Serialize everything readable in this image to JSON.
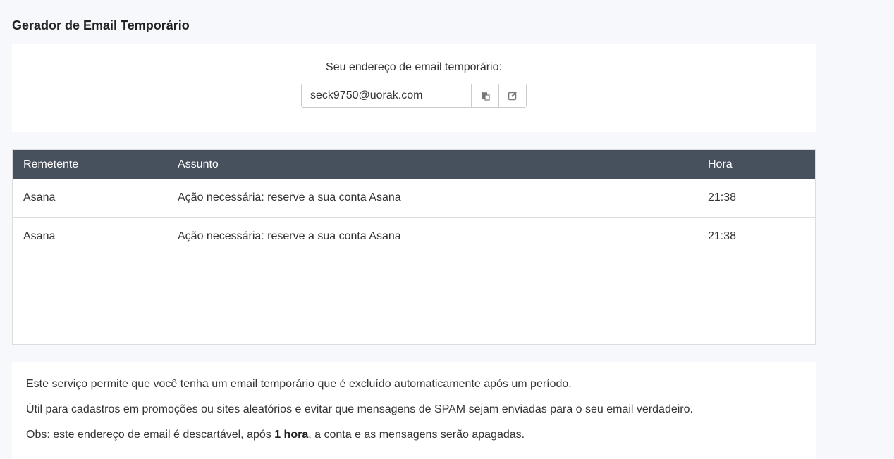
{
  "page": {
    "title": "Gerador de Email Temporário"
  },
  "email": {
    "label": "Seu endereço de email temporário:",
    "address": "seck9750@uorak.com"
  },
  "inbox": {
    "headers": {
      "sender": "Remetente",
      "subject": "Assunto",
      "time": "Hora"
    },
    "rows": [
      {
        "sender": "Asana",
        "subject": "Ação necessária: reserve a sua conta Asana",
        "time": "21:38"
      },
      {
        "sender": "Asana",
        "subject": "Ação necessária: reserve a sua conta Asana",
        "time": "21:38"
      }
    ]
  },
  "info": {
    "line1": "Este serviço permite que você tenha um email temporário que é excluído automaticamente após um período.",
    "line2": "Útil para cadastros em promoções ou sites aleatórios e evitar que mensagens de SPAM sejam enviadas para o seu email verdadeiro.",
    "line3_prefix": "Obs: este endereço de email é descartável, após ",
    "line3_bold": "1 hora",
    "line3_suffix": ", a conta e as mensagens serão apagadas."
  },
  "icons": {
    "copy": "clipboard-icon",
    "edit": "edit-icon"
  },
  "colors": {
    "table_header": "#46515d",
    "background": "#f7f8fb"
  }
}
